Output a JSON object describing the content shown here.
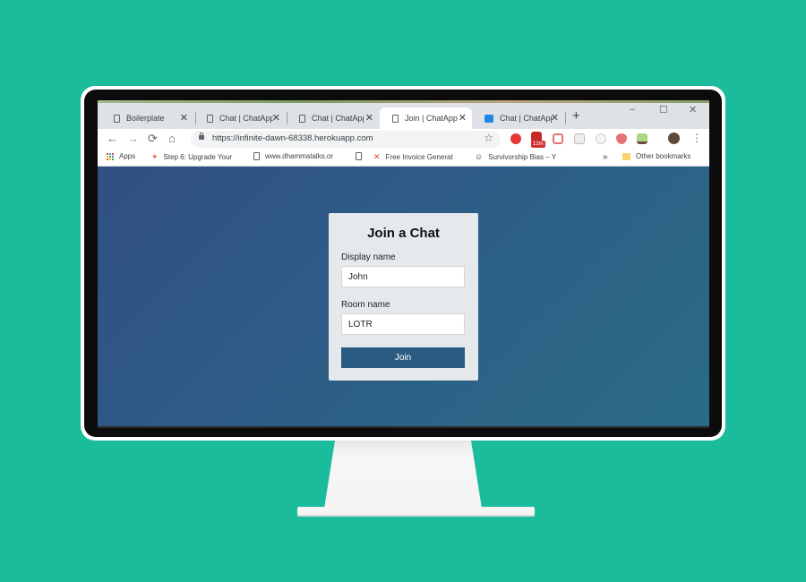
{
  "tabs": [
    {
      "title": "Boilerplate",
      "icon": "doc-icon",
      "active": false
    },
    {
      "title": "Chat | ChatApp",
      "icon": "doc-icon",
      "active": false
    },
    {
      "title": "Chat | ChatApp",
      "icon": "doc-icon",
      "active": false
    },
    {
      "title": "Join | ChatApp",
      "icon": "doc-icon",
      "active": true
    },
    {
      "title": "Chat | ChatApp",
      "icon": "chat-favicon",
      "active": false
    }
  ],
  "window_controls": {
    "minimize": "–",
    "maximize": "☐",
    "close": "✕"
  },
  "toolbar": {
    "back": "←",
    "forward": "→",
    "reload": "⟳",
    "home": "⌂",
    "url": "https://infinite-dawn-68338.herokuapp.com",
    "star": "☆",
    "badge": "12m",
    "menu": "⋮"
  },
  "bookmarks": {
    "apps": "Apps",
    "items": [
      {
        "label": "Step 6: Upgrade Your"
      },
      {
        "label": "www.dhammatalks.or"
      },
      {
        "label": "Free Invoice Generat"
      },
      {
        "label": "Survivorship Bias – Y"
      }
    ],
    "overflow": "»",
    "other": "Other bookmarks"
  },
  "form": {
    "title": "Join a Chat",
    "display_name_label": "Display name",
    "display_name_value": "John",
    "room_name_label": "Room name",
    "room_name_value": "LOTR",
    "join_label": "Join"
  },
  "colors": {
    "background": "#1abc9c",
    "page_gradient_start": "#314f83",
    "page_gradient_end": "#2a6b86",
    "card": "#e6e9ec",
    "button": "#2a5b81"
  }
}
